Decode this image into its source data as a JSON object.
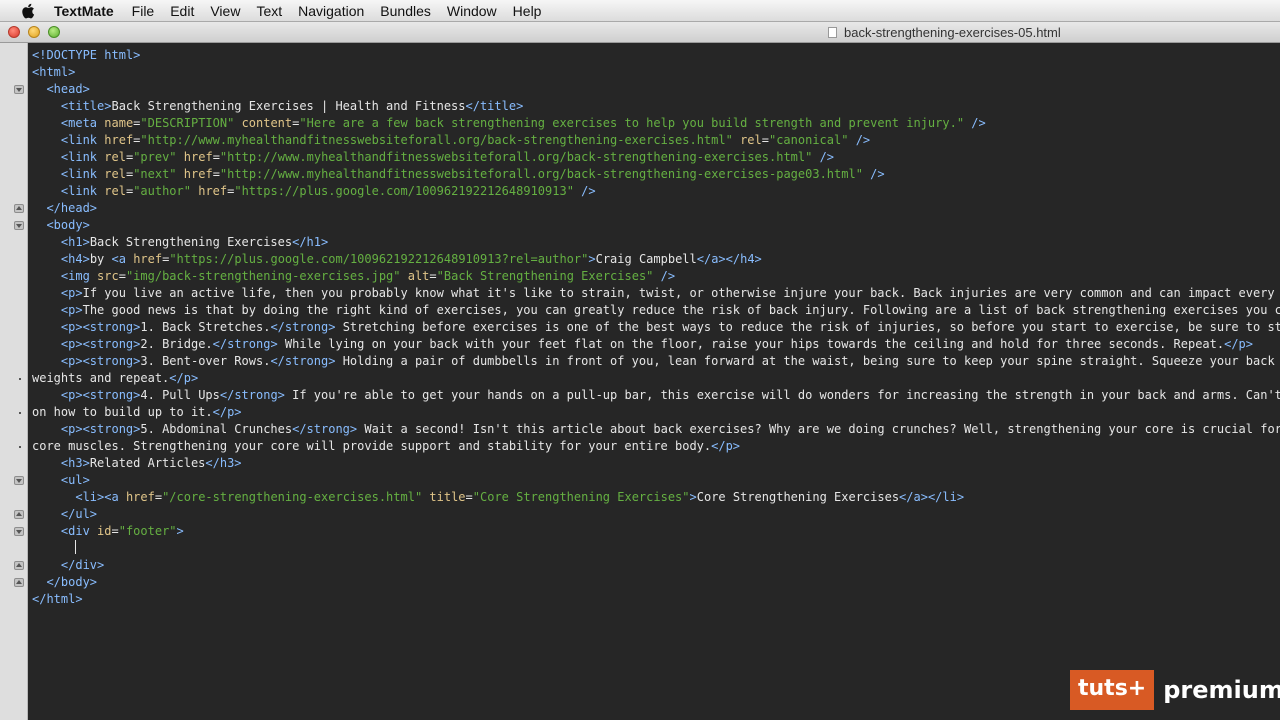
{
  "menubar": {
    "app_name": "TextMate",
    "items": [
      "File",
      "Edit",
      "View",
      "Text",
      "Navigation",
      "Bundles",
      "Window",
      "Help"
    ]
  },
  "window": {
    "title": "back-strengthening-exercises-05.html"
  },
  "editor": {
    "lines": [
      [
        [
          "t",
          "<!DOCTYPE html>"
        ]
      ],
      [
        [
          "t",
          "<html>"
        ]
      ],
      [
        [
          "x",
          "  "
        ],
        [
          "t",
          "<head>"
        ]
      ],
      [
        [
          "x",
          "    "
        ],
        [
          "t",
          "<title>"
        ],
        [
          "x",
          "Back Strengthening Exercises | Health and Fitness"
        ],
        [
          "t",
          "</title>"
        ]
      ],
      [
        [
          "x",
          "    "
        ],
        [
          "t",
          "<meta "
        ],
        [
          "a",
          "name"
        ],
        [
          "x",
          "="
        ],
        [
          "s",
          "\"DESCRIPTION\""
        ],
        [
          "x",
          " "
        ],
        [
          "a",
          "content"
        ],
        [
          "x",
          "="
        ],
        [
          "s",
          "\"Here are a few back strengthening exercises to help you build strength and prevent injury.\""
        ],
        [
          "x",
          " "
        ],
        [
          "t",
          "/>"
        ]
      ],
      [
        [
          "x",
          "    "
        ],
        [
          "t",
          "<link "
        ],
        [
          "a",
          "href"
        ],
        [
          "x",
          "="
        ],
        [
          "s",
          "\"http://www.myhealthandfitnesswebsiteforall.org/back-strengthening-exercises.html\""
        ],
        [
          "x",
          " "
        ],
        [
          "a",
          "rel"
        ],
        [
          "x",
          "="
        ],
        [
          "s",
          "\"canonical\""
        ],
        [
          "x",
          " "
        ],
        [
          "t",
          "/>"
        ]
      ],
      [
        [
          "x",
          "    "
        ],
        [
          "t",
          "<link "
        ],
        [
          "a",
          "rel"
        ],
        [
          "x",
          "="
        ],
        [
          "s",
          "\"prev\""
        ],
        [
          "x",
          " "
        ],
        [
          "a",
          "href"
        ],
        [
          "x",
          "="
        ],
        [
          "s",
          "\"http://www.myhealthandfitnesswebsiteforall.org/back-strengthening-exercises.html\""
        ],
        [
          "x",
          " "
        ],
        [
          "t",
          "/>"
        ]
      ],
      [
        [
          "x",
          "    "
        ],
        [
          "t",
          "<link "
        ],
        [
          "a",
          "rel"
        ],
        [
          "x",
          "="
        ],
        [
          "s",
          "\"next\""
        ],
        [
          "x",
          " "
        ],
        [
          "a",
          "href"
        ],
        [
          "x",
          "="
        ],
        [
          "s",
          "\"http://www.myhealthandfitnesswebsiteforall.org/back-strengthening-exercises-page03.html\""
        ],
        [
          "x",
          " "
        ],
        [
          "t",
          "/>"
        ]
      ],
      [
        [
          "x",
          "    "
        ],
        [
          "t",
          "<link "
        ],
        [
          "a",
          "rel"
        ],
        [
          "x",
          "="
        ],
        [
          "s",
          "\"author\""
        ],
        [
          "x",
          " "
        ],
        [
          "a",
          "href"
        ],
        [
          "x",
          "="
        ],
        [
          "s",
          "\"https://plus.google.com/100962192212648910913\""
        ],
        [
          "x",
          " "
        ],
        [
          "t",
          "/>"
        ]
      ],
      [
        [
          "x",
          "  "
        ],
        [
          "t",
          "</head>"
        ]
      ],
      [
        [
          "x",
          "  "
        ],
        [
          "t",
          "<body>"
        ]
      ],
      [
        [
          "x",
          "    "
        ],
        [
          "t",
          "<h1>"
        ],
        [
          "x",
          "Back Strengthening Exercises"
        ],
        [
          "t",
          "</h1>"
        ]
      ],
      [
        [
          "x",
          "    "
        ],
        [
          "t",
          "<h4>"
        ],
        [
          "x",
          "by "
        ],
        [
          "t",
          "<a "
        ],
        [
          "a",
          "href"
        ],
        [
          "x",
          "="
        ],
        [
          "s",
          "\"https://plus.google.com/100962192212648910913?rel=author\""
        ],
        [
          "t",
          ">"
        ],
        [
          "x",
          "Craig Campbell"
        ],
        [
          "t",
          "</a></h4>"
        ]
      ],
      [
        [
          "x",
          "    "
        ],
        [
          "t",
          "<img "
        ],
        [
          "a",
          "src"
        ],
        [
          "x",
          "="
        ],
        [
          "s",
          "\"img/back-strengthening-exercises.jpg\""
        ],
        [
          "x",
          " "
        ],
        [
          "a",
          "alt"
        ],
        [
          "x",
          "="
        ],
        [
          "s",
          "\"Back Strengthening Exercises\""
        ],
        [
          "x",
          " "
        ],
        [
          "t",
          "/>"
        ]
      ],
      [
        [
          "x",
          "    "
        ],
        [
          "t",
          "<p>"
        ],
        [
          "x",
          "If you live an active life, then you probably know what it's like to strain, twist, or otherwise injure your back. Back injuries are very common and can impact every a"
        ]
      ],
      [
        [
          "x",
          "    "
        ],
        [
          "t",
          "<p>"
        ],
        [
          "x",
          "The good news is that by doing the right kind of exercises, you can greatly reduce the risk of back injury. Following are a list of back strengthening exercises you ca"
        ]
      ],
      [
        [
          "x",
          "    "
        ],
        [
          "t",
          "<p><strong>"
        ],
        [
          "x",
          "1. Back Stretches."
        ],
        [
          "t",
          "</strong>"
        ],
        [
          "x",
          " Stretching before exercises is one of the best ways to reduce the risk of injuries, so before you start to exercise, be sure to str"
        ]
      ],
      [
        [
          "x",
          "    "
        ],
        [
          "t",
          "<p><strong>"
        ],
        [
          "x",
          "2. Bridge."
        ],
        [
          "t",
          "</strong>"
        ],
        [
          "x",
          " While lying on your back with your feet flat on the floor, raise your hips towards the ceiling and hold for three seconds. Repeat."
        ],
        [
          "t",
          "</p>"
        ]
      ],
      [
        [
          "x",
          "    "
        ],
        [
          "t",
          "<p><strong>"
        ],
        [
          "x",
          "3. Bent-over Rows."
        ],
        [
          "t",
          "</strong>"
        ],
        [
          "x",
          " Holding a pair of dumbbells in front of you, lean forward at the waist, being sure to keep your spine straight. Squeeze your back m"
        ]
      ],
      [
        [
          "x",
          "weights and repeat."
        ],
        [
          "t",
          "</p>"
        ]
      ],
      [
        [
          "x",
          "    "
        ],
        [
          "t",
          "<p><strong>"
        ],
        [
          "x",
          "4. Pull Ups"
        ],
        [
          "t",
          "</strong>"
        ],
        [
          "x",
          " If you're able to get your hands on a pull-up bar, this exercise will do wonders for increasing the strength in your back and arms. Can't"
        ]
      ],
      [
        [
          "x",
          "on how to build up to it."
        ],
        [
          "t",
          "</p>"
        ]
      ],
      [
        [
          "x",
          "    "
        ],
        [
          "t",
          "<p><strong>"
        ],
        [
          "x",
          "5. Abdominal Crunches"
        ],
        [
          "t",
          "</strong>"
        ],
        [
          "x",
          " Wait a second! Isn't this article about back exercises? Why are we doing crunches? Well, strengthening your core is crucial for"
        ]
      ],
      [
        [
          "x",
          "core muscles. Strengthening your core will provide support and stability for your entire body."
        ],
        [
          "t",
          "</p>"
        ]
      ],
      [
        [
          "x",
          "    "
        ],
        [
          "t",
          "<h3>"
        ],
        [
          "x",
          "Related Articles"
        ],
        [
          "t",
          "</h3>"
        ]
      ],
      [
        [
          "x",
          "    "
        ],
        [
          "t",
          "<ul>"
        ]
      ],
      [
        [
          "x",
          "      "
        ],
        [
          "t",
          "<li><a "
        ],
        [
          "a",
          "href"
        ],
        [
          "x",
          "="
        ],
        [
          "s",
          "\"/core-strengthening-exercises.html\""
        ],
        [
          "x",
          " "
        ],
        [
          "a",
          "title"
        ],
        [
          "x",
          "="
        ],
        [
          "s",
          "\"Core Strengthening Exercises\""
        ],
        [
          "t",
          ">"
        ],
        [
          "x",
          "Core Strengthening Exercises"
        ],
        [
          "t",
          "</a></li>"
        ]
      ],
      [
        [
          "x",
          "    "
        ],
        [
          "t",
          "</ul>"
        ]
      ],
      [
        [
          "x",
          "    "
        ],
        [
          "t",
          "<div "
        ],
        [
          "a",
          "id"
        ],
        [
          "x",
          "="
        ],
        [
          "s",
          "\"footer\""
        ],
        [
          "t",
          ">"
        ]
      ],
      [
        [
          "x",
          "      "
        ],
        [
          "caret",
          ""
        ]
      ],
      [
        [
          "x",
          "    "
        ],
        [
          "t",
          "</div>"
        ]
      ],
      [
        [
          "x",
          "  "
        ],
        [
          "t",
          "</body>"
        ]
      ],
      [
        [
          "t",
          "</html>"
        ]
      ]
    ]
  },
  "gutter": {
    "fold_markers": [
      {
        "line": 3,
        "state": "open"
      },
      {
        "line": 10,
        "state": "close"
      },
      {
        "line": 11,
        "state": "open"
      },
      {
        "line": 26,
        "state": "open"
      },
      {
        "line": 28,
        "state": "close"
      },
      {
        "line": 29,
        "state": "open"
      },
      {
        "line": 31,
        "state": "close"
      },
      {
        "line": 32,
        "state": "close"
      }
    ],
    "wrap_lines": [
      20,
      22,
      24
    ]
  },
  "logo": {
    "box_text": "tuts+",
    "text": "premium"
  }
}
